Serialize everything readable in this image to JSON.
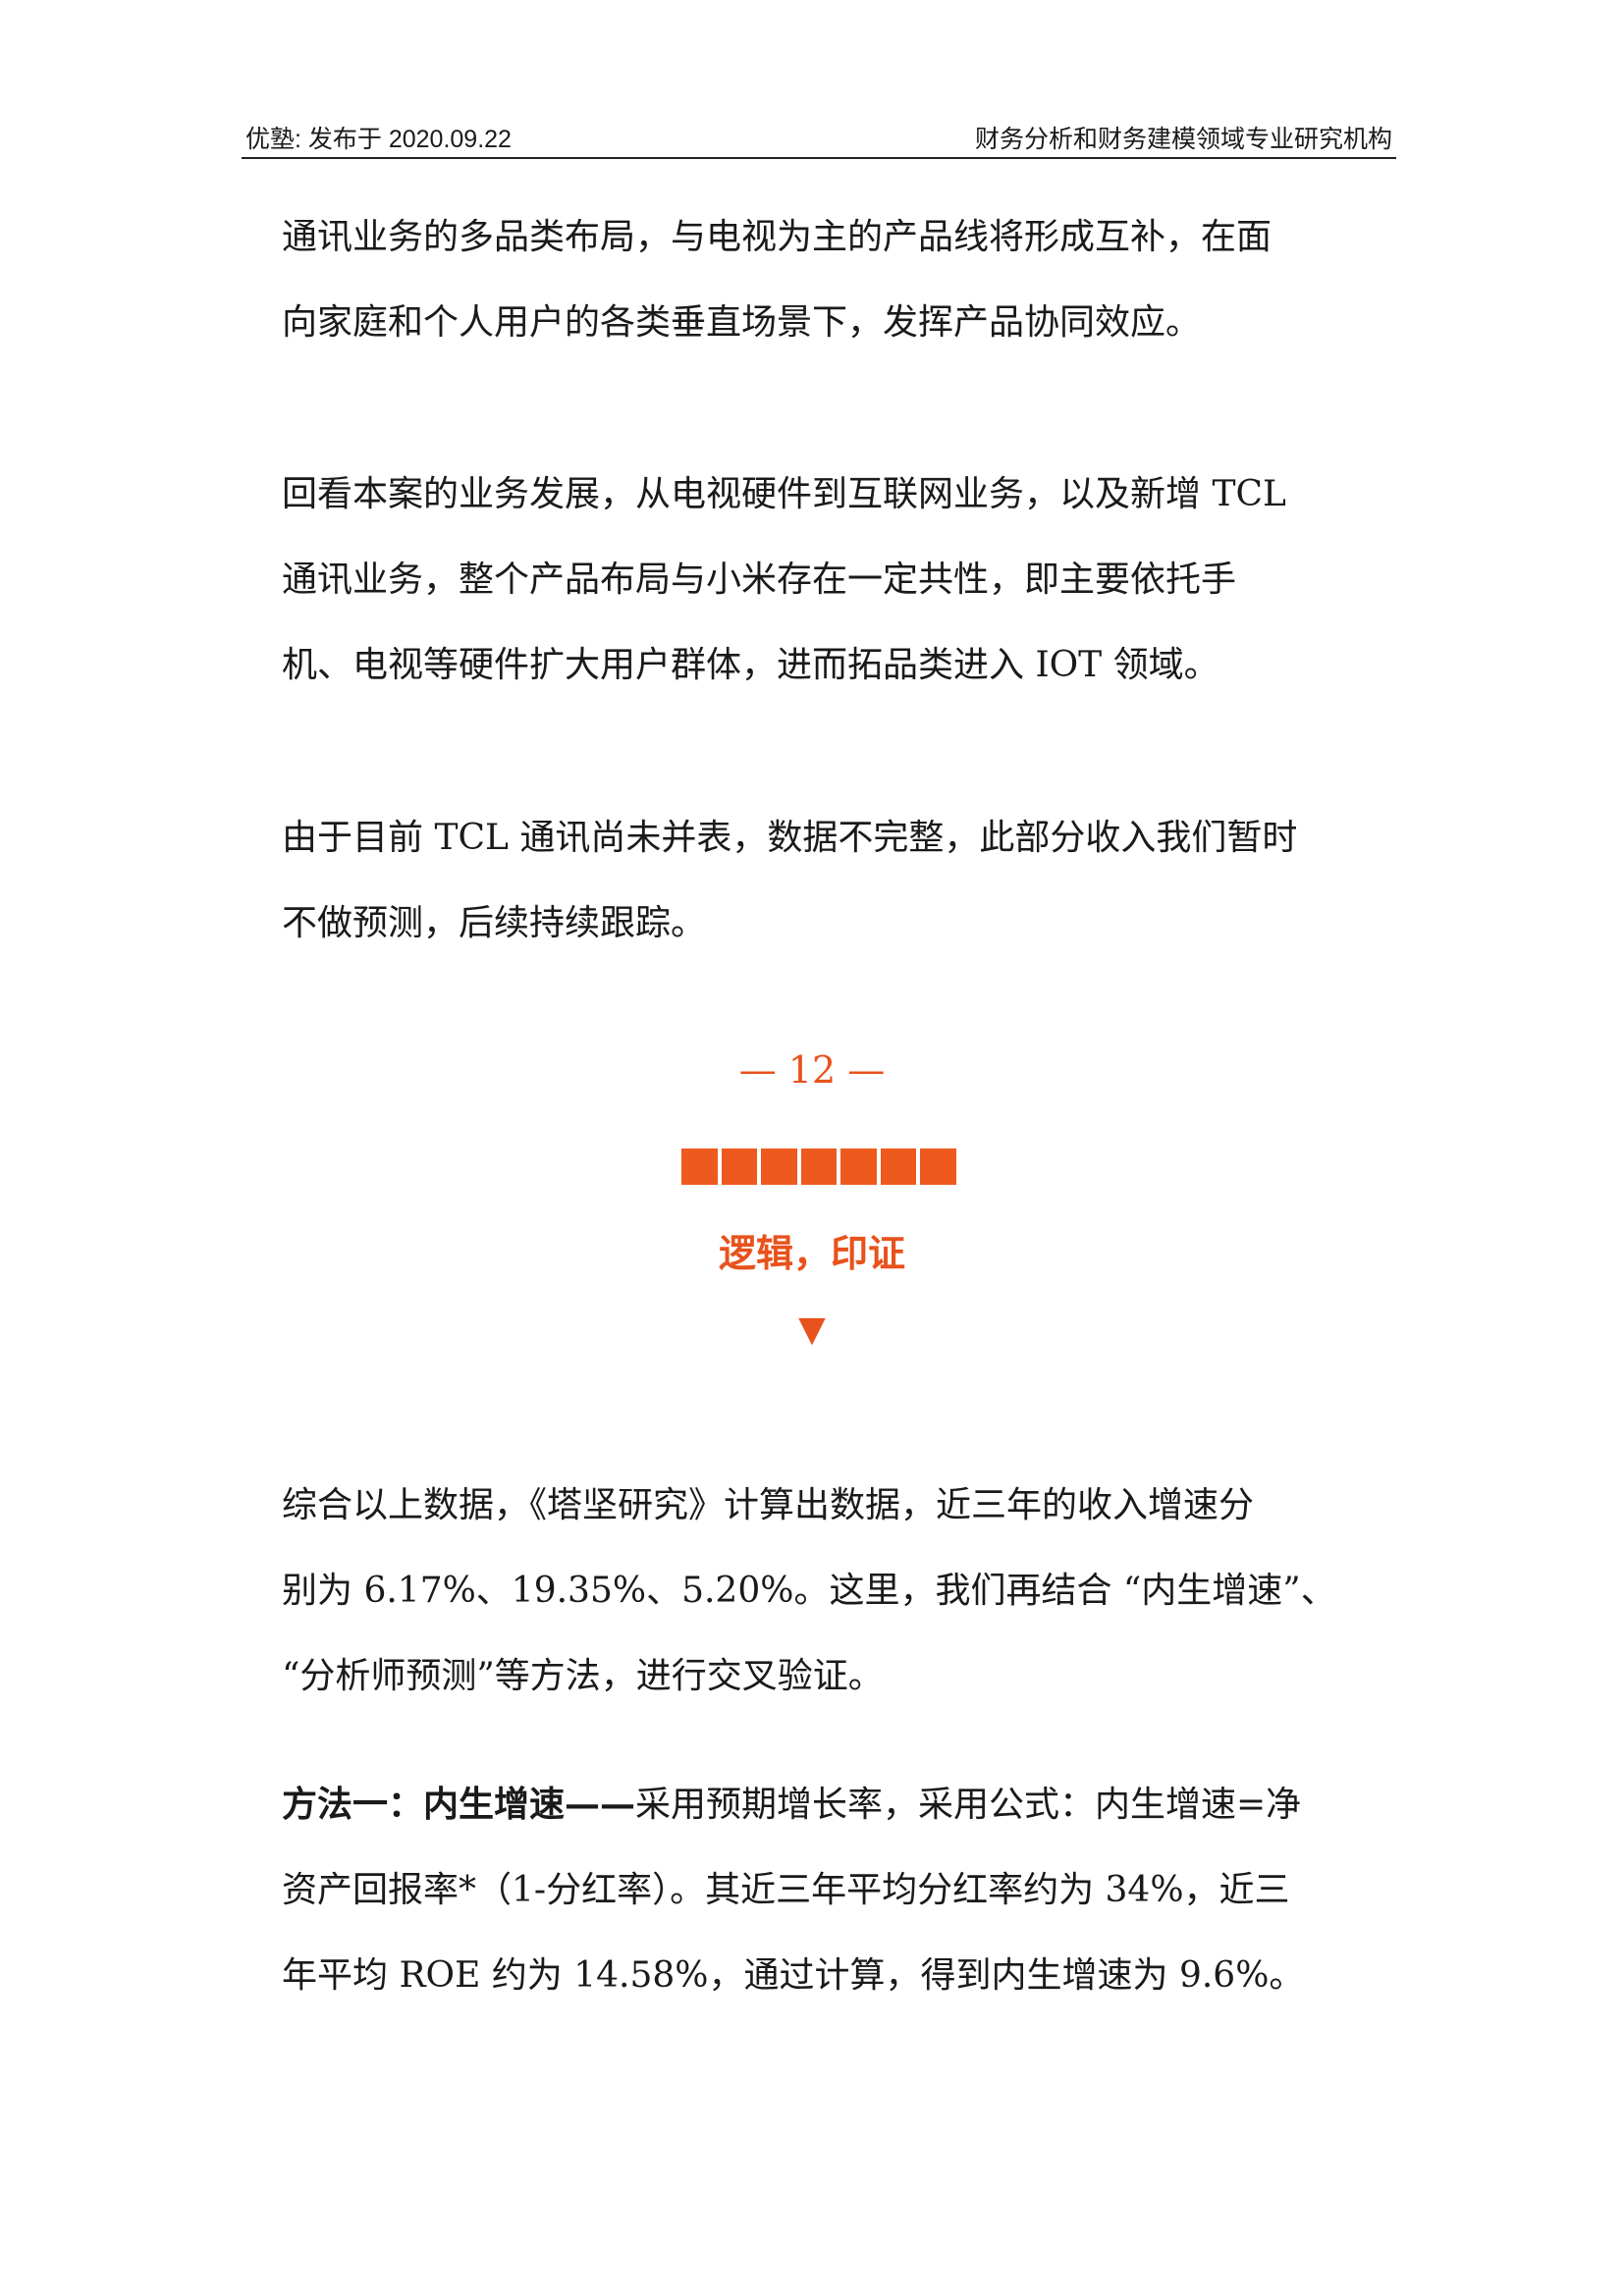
{
  "header": {
    "left": "优塾: 发布于 2020.09.22",
    "right": "财务分析和财务建模领域专业研究机构"
  },
  "paragraphs": {
    "p1": [
      "通讯业务的多品类布局，与电视为主的产品线将形成互补，在面",
      "向家庭和个人用户的各类垂直场景下，发挥产品协同效应。"
    ],
    "p2": [
      "回看本案的业务发展，从电视硬件到互联网业务，以及新增 TCL",
      "通讯业务，整个产品布局与小米存在一定共性，即主要依托手",
      "机、电视等硬件扩大用户群体，进而拓品类进入 IOT 领域。"
    ],
    "p3": [
      "由于目前 TCL 通讯尚未并表，数据不完整，此部分收入我们暂时",
      "不做预测，后续持续跟踪。"
    ],
    "p4": [
      "综合以上数据，《塔坚研究》计算出数据，近三年的收入增速分",
      "别为 6.17%、19.35%、5.20%。这里，我们再结合 “内生增速”、",
      "“分析师预测”等方法，进行交叉验证。"
    ],
    "p5_bold": "方法一：内生增速——",
    "p5": [
      "采用预期增长率，采用公式：内生增速=净",
      "资产回报率*（1-分红率）。其近三年平均分红率约为 34%，近三",
      "年平均 ROE 约为 14.58%，通过计算，得到内生增速为 9.6%。"
    ]
  },
  "section": {
    "number": "—   12  —",
    "title": "逻辑，印证",
    "arrow": "▼",
    "accent": "#e8521c"
  }
}
